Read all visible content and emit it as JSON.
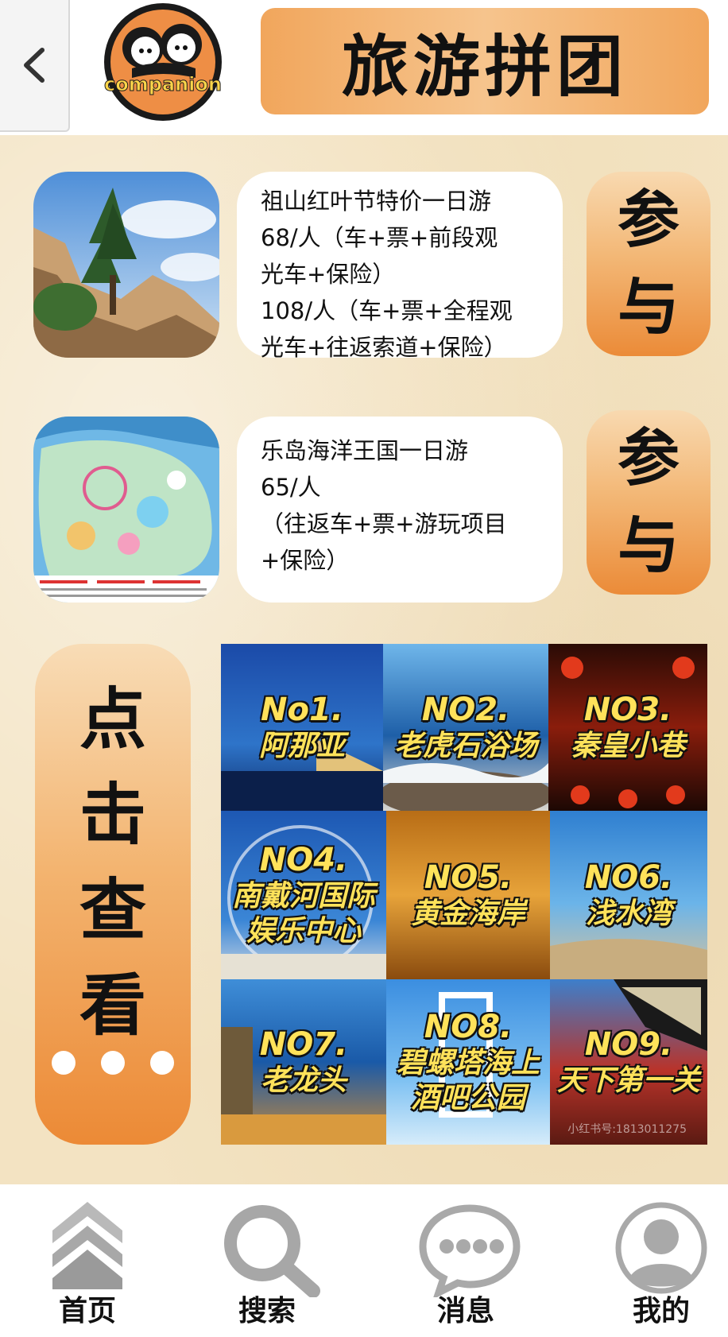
{
  "header": {
    "logo_text": "companion",
    "title": "旅游拼团"
  },
  "trips": [
    {
      "lines": [
        "祖山红叶节特价一日游",
        "68/人（车+票+前段观",
        "光车+保险）",
        "108/人（车+票+全程观",
        "光车+往返索道+保险）"
      ],
      "join_chars": [
        "参",
        "与"
      ]
    },
    {
      "lines": [
        "乐岛海洋王国一日游",
        "65/人",
        "（往返车+票+游玩项目",
        "+保险）"
      ],
      "join_chars": [
        "参",
        "与"
      ]
    }
  ],
  "view_more": {
    "chars": [
      "点",
      "击",
      "查",
      "看"
    ]
  },
  "attractions": [
    {
      "no": "No1.",
      "name": [
        "阿那亚"
      ]
    },
    {
      "no": "NO2.",
      "name": [
        "老虎石浴场"
      ]
    },
    {
      "no": "NO3.",
      "name": [
        "秦皇小巷"
      ]
    },
    {
      "no": "NO4.",
      "name": [
        "南戴河国际",
        "娱乐中心"
      ]
    },
    {
      "no": "NO5.",
      "name": [
        "黄金海岸"
      ]
    },
    {
      "no": "NO6.",
      "name": [
        "浅水湾"
      ]
    },
    {
      "no": "NO7.",
      "name": [
        "老龙头"
      ]
    },
    {
      "no": "NO8.",
      "name": [
        "碧螺塔海上",
        "酒吧公园"
      ]
    },
    {
      "no": "NO9.",
      "name": [
        "天下第一关"
      ]
    }
  ],
  "watermark": "小红书号:1813011275",
  "nav": [
    {
      "label": "首页",
      "icon": "home-chevrons-icon"
    },
    {
      "label": "搜索",
      "icon": "search-icon"
    },
    {
      "label": "消息",
      "icon": "message-bubble-icon"
    },
    {
      "label": "我的",
      "icon": "user-avatar-icon"
    }
  ]
}
